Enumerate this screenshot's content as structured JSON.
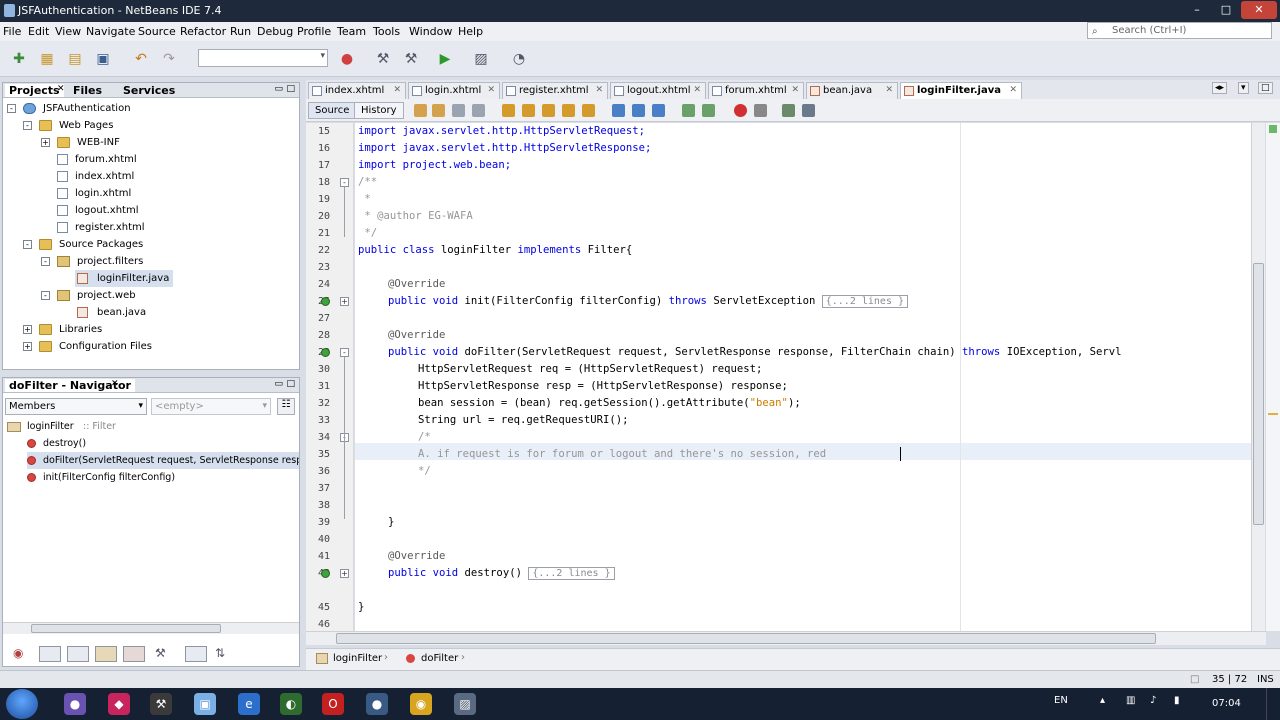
{
  "window": {
    "title": "JSFAuthentication - NetBeans IDE 7.4"
  },
  "menu": [
    "File",
    "Edit",
    "View",
    "Navigate",
    "Source",
    "Refactor",
    "Run",
    "Debug",
    "Profile",
    "Team",
    "Tools",
    "Window",
    "Help"
  ],
  "search": {
    "placeholder": "Search (Ctrl+I)"
  },
  "projects_panel": {
    "tabs": [
      "Projects",
      "Files",
      "Services"
    ],
    "tree": [
      {
        "label": "JSFAuthentication",
        "icon": "project-icon"
      },
      {
        "label": "Web Pages",
        "icon": "folder-icon"
      },
      {
        "label": "WEB-INF",
        "icon": "folder-icon"
      },
      {
        "label": "forum.xhtml",
        "icon": "xhtml-file-icon"
      },
      {
        "label": "index.xhtml",
        "icon": "xhtml-file-icon"
      },
      {
        "label": "login.xhtml",
        "icon": "xhtml-file-icon"
      },
      {
        "label": "logout.xhtml",
        "icon": "xhtml-file-icon"
      },
      {
        "label": "register.xhtml",
        "icon": "xhtml-file-icon"
      },
      {
        "label": "Source Packages",
        "icon": "folder-icon"
      },
      {
        "label": "project.filters",
        "icon": "package-icon"
      },
      {
        "label": "loginFilter.java",
        "icon": "java-file-icon"
      },
      {
        "label": "project.web",
        "icon": "package-icon"
      },
      {
        "label": "bean.java",
        "icon": "java-file-icon"
      },
      {
        "label": "Libraries",
        "icon": "folder-icon"
      },
      {
        "label": "Configuration Files",
        "icon": "folder-icon"
      }
    ]
  },
  "navigator": {
    "title": "doFilter - Navigator",
    "members_label": "Members",
    "filter_placeholder": "<empty>",
    "root": {
      "name": "loginFilter",
      "suffix": " :: Filter"
    },
    "items": [
      "destroy()",
      "doFilter(ServletRequest request, ServletResponse response",
      "init(FilterConfig filterConfig)"
    ]
  },
  "editor": {
    "tabs": [
      "index.xhtml",
      "login.xhtml",
      "register.xhtml",
      "logout.xhtml",
      "forum.xhtml",
      "bean.java",
      "loginFilter.java"
    ],
    "active_tab": "loginFilter.java",
    "source_label": "Source",
    "history_label": "History",
    "line_numbers": [
      "15",
      "16",
      "17",
      "18",
      "19",
      "20",
      "21",
      "22",
      "23",
      "24",
      "25",
      "27",
      "28",
      "29",
      "30",
      "31",
      "32",
      "33",
      "34",
      "35",
      "36",
      "37",
      "38",
      "39",
      "40",
      "41",
      "42",
      "45",
      "46"
    ],
    "fold_label_init": "{...2 lines }",
    "fold_label_destroy": "{...2 lines }",
    "lines": {
      "l15": "import javax.servlet.http.HttpServletRequest;",
      "l16": "import javax.servlet.http.HttpServletResponse;",
      "l17": "import project.web.bean;",
      "l18": "/**",
      "l19": " *",
      "l20": " * @author EG-WAFA",
      "l21": " */",
      "l22a": "public class ",
      "l22b": "loginFilter ",
      "l22c": "implements ",
      "l22d": "Filter{",
      "l24": "@Override",
      "l25a": "public void ",
      "l25b": "init(FilterConfig filterConfig) ",
      "l25c": "throws ",
      "l25d": "ServletException ",
      "l28": "@Override",
      "l29a": "public void ",
      "l29b": "doFilter(ServletRequest request, ServletResponse response, FilterChain chain) ",
      "l29c": "throws ",
      "l29d": "IOException, Servl",
      "l30": "HttpServletRequest req = (HttpServletRequest) request;",
      "l31": "HttpServletResponse resp = (HttpServletResponse) response;",
      "l32a": "bean session = (bean) req.getSession().getAttribute(",
      "l32b": "\"bean\"",
      "l32c": ");",
      "l33": "String url = req.getRequestURI();",
      "l34": "/*",
      "l35": "A. if request is for forum or logout and there's no session, red",
      "l36": "*/",
      "l39": "}",
      "l41": "@Override",
      "l42a": "public void ",
      "l42b": "destroy() ",
      "l45": "}"
    }
  },
  "breadcrumb": [
    "loginFilter",
    "doFilter"
  ],
  "status": {
    "position": "35 | 72",
    "mode": "INS"
  },
  "taskbar": {
    "lang": "EN",
    "time": "07:04"
  }
}
